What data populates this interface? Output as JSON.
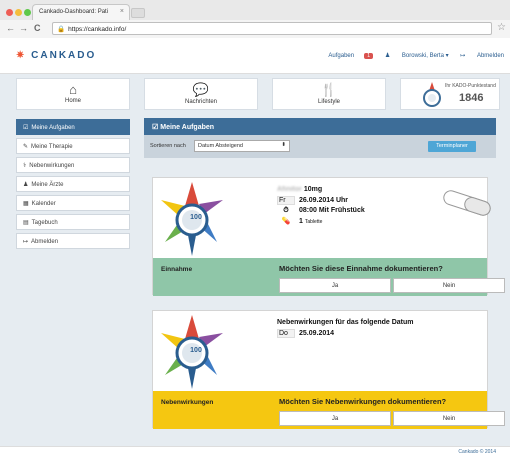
{
  "browser": {
    "tab_title": "Cankado-Dashboard: Pati",
    "tab_close": "×",
    "url": "https://cankado.info/",
    "back": "←",
    "forward": "→",
    "reload": "C",
    "star": "☆"
  },
  "header": {
    "logo": "CANKADO",
    "tasks_label": "Aufgaben",
    "tasks_count": "1",
    "user": "Borowski, Berta",
    "logout": "Abmelden"
  },
  "tiles": [
    {
      "label": "Home",
      "icon": "home-icon"
    },
    {
      "label": "Nachrichten",
      "icon": "chat-icon"
    },
    {
      "label": "Lifestyle",
      "icon": "cutlery-icon"
    }
  ],
  "points": {
    "label": "Ihr KADO-Punktestand",
    "value": "1846"
  },
  "sidebar": {
    "items": [
      {
        "label": "Meine Aufgaben",
        "icon": "☑"
      },
      {
        "label": "Meine Therapie",
        "icon": "✎"
      },
      {
        "label": "Nebenwirkungen",
        "icon": "⚕"
      },
      {
        "label": "Meine Ärzte",
        "icon": "♟"
      },
      {
        "label": "Kalender",
        "icon": "▦"
      },
      {
        "label": "Tagebuch",
        "icon": "▤"
      },
      {
        "label": "Abmelden",
        "icon": "↦"
      }
    ]
  },
  "main": {
    "title": "Meine Aufgaben",
    "sort_label": "Sortieren nach",
    "sort_value": "Datum Absteigend",
    "calendar_button": "Terminplaner"
  },
  "card1": {
    "score": "100",
    "med_name": "10mg",
    "weekday": "Fr",
    "date": "26.09.2014 Uhr",
    "time": "08:00 Mit Frühstück",
    "count": "1",
    "unit": "Tablette",
    "bar_label": "Einnahme",
    "question": "Möchten Sie diese Einnahme dokumentieren?",
    "yes": "Ja",
    "no": "Nein"
  },
  "card2": {
    "score": "100",
    "title": "Nebenwirkungen für das folgende Datum",
    "weekday": "Do",
    "date": "25.09.2014",
    "bar_label": "Nebenwirkungen",
    "question": "Möchten Sie Nebenwirkungen dokumentieren?",
    "yes": "Ja",
    "no": "Nein"
  },
  "footer": {
    "text": "Cankado © 2014"
  },
  "colors": {
    "primary": "#3d6d98",
    "green_bar": "#8fc6a8",
    "yellow_bar": "#f5c711",
    "button_blue": "#4ea6d6"
  }
}
